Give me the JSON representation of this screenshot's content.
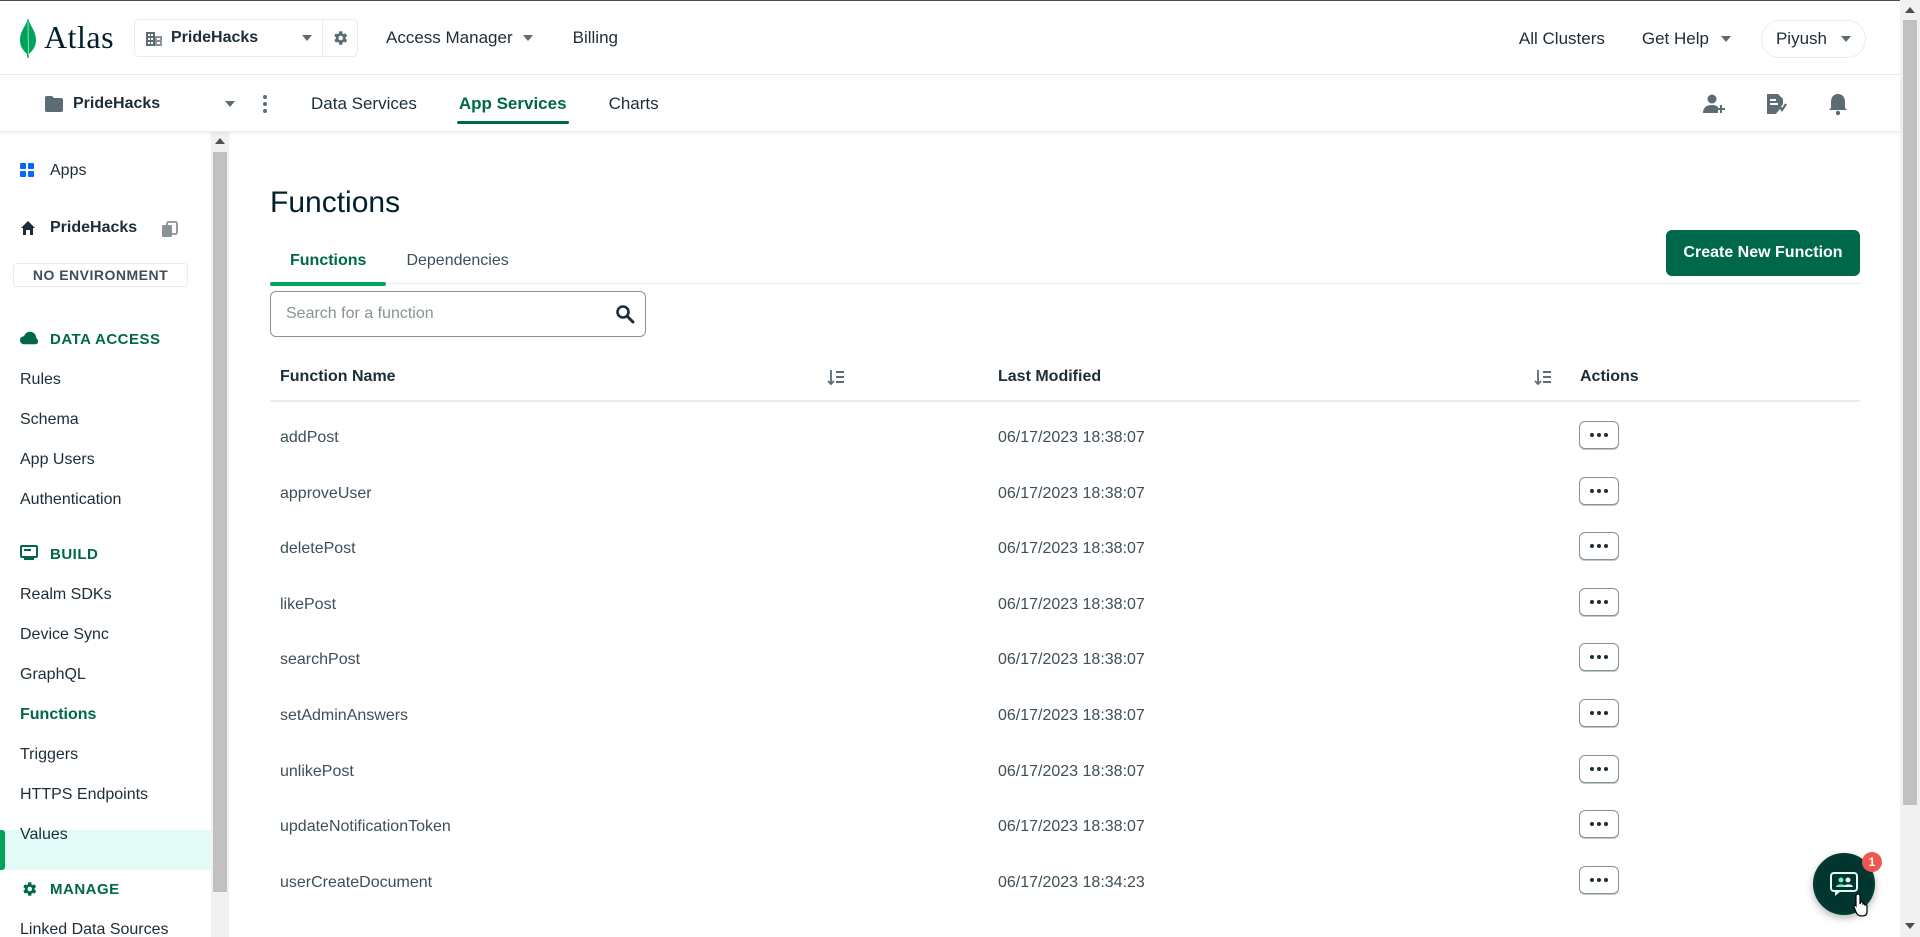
{
  "brand": {
    "name": "Atlas",
    "accent": "#00684a",
    "leaf_color": "#00a35c"
  },
  "topbar": {
    "org": "PrideHacks",
    "nav": [
      "Access Manager",
      "Billing"
    ],
    "right": {
      "all_clusters": "All Clusters",
      "get_help": "Get Help",
      "user": "Piyush"
    }
  },
  "subbar": {
    "project": "PrideHacks",
    "tabs": [
      "Data Services",
      "App Services",
      "Charts"
    ],
    "active_tab": "App Services",
    "icons": [
      "add-user-icon",
      "activity-feed-icon",
      "bell-icon"
    ]
  },
  "sidebar": {
    "apps": "Apps",
    "app_name": "PrideHacks",
    "environment": "NO ENVIRONMENT",
    "data_access": {
      "heading": "DATA ACCESS",
      "items": [
        "Rules",
        "Schema",
        "App Users",
        "Authentication"
      ]
    },
    "build": {
      "heading": "BUILD",
      "items": [
        "Realm SDKs",
        "Device Sync",
        "GraphQL",
        "Functions",
        "Triggers",
        "HTTPS Endpoints",
        "Values"
      ]
    },
    "manage": {
      "heading": "MANAGE",
      "items": [
        "Linked Data Sources"
      ]
    },
    "active": "Functions"
  },
  "main": {
    "title": "Functions",
    "tabs": [
      "Functions",
      "Dependencies"
    ],
    "active_tab": "Functions",
    "create_button": "Create New Function",
    "search_placeholder": "Search for a function",
    "columns": [
      "Function Name",
      "Last Modified",
      "Actions"
    ],
    "rows": [
      {
        "name": "addPost",
        "modified": "06/17/2023 18:38:07"
      },
      {
        "name": "approveUser",
        "modified": "06/17/2023 18:38:07"
      },
      {
        "name": "deletePost",
        "modified": "06/17/2023 18:38:07"
      },
      {
        "name": "likePost",
        "modified": "06/17/2023 18:38:07"
      },
      {
        "name": "searchPost",
        "modified": "06/17/2023 18:38:07"
      },
      {
        "name": "setAdminAnswers",
        "modified": "06/17/2023 18:38:07"
      },
      {
        "name": "unlikePost",
        "modified": "06/17/2023 18:38:07"
      },
      {
        "name": "updateNotificationToken",
        "modified": "06/17/2023 18:38:07"
      },
      {
        "name": "userCreateDocument",
        "modified": "06/17/2023 18:34:23"
      }
    ]
  },
  "chat": {
    "badge": "1"
  }
}
